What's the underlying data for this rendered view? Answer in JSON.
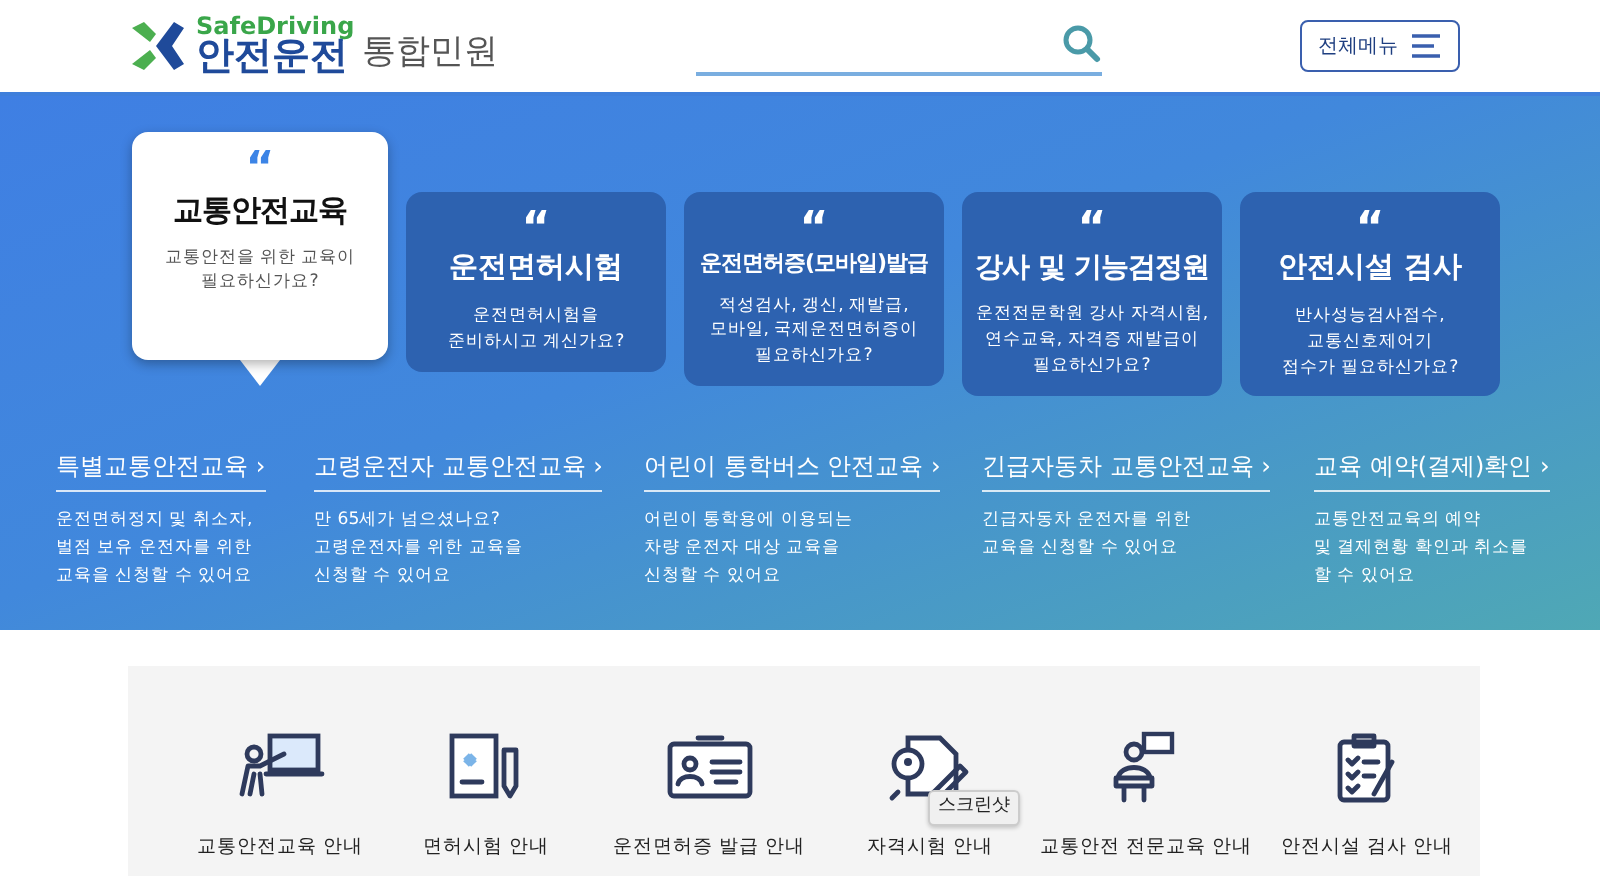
{
  "header": {
    "logo": {
      "tagline": "SafeDriving",
      "name": "안전운전",
      "suffix": "통합민원"
    },
    "menu_button": "전체메뉴"
  },
  "hero": {
    "cards": [
      {
        "mark": "“",
        "title": "교통안전교육",
        "lines": [
          "교통안전을 위한 교육이",
          "필요하신가요?"
        ],
        "selected": true
      },
      {
        "mark": "“",
        "title": "운전면허시험",
        "lines": [
          "운전면허시험을",
          "준비하시고 계신가요?"
        ],
        "selected": false
      },
      {
        "mark": "“",
        "title": "운전면허증(모바일)발급",
        "lines": [
          "적성검사, 갱신, 재발급,",
          "모바일, 국제운전면허증이",
          "필요하신가요?"
        ],
        "selected": false
      },
      {
        "mark": "“",
        "title": "강사 및 기능검정원",
        "lines": [
          "운전전문학원 강사 자격시험,",
          "연수교육, 자격증 재발급이",
          "필요하신가요?"
        ],
        "selected": false
      },
      {
        "mark": "“",
        "title": "안전시설 검사",
        "lines": [
          "반사성능검사접수,",
          "교통신호제어기",
          "접수가 필요하신가요?"
        ],
        "selected": false
      }
    ],
    "links": [
      {
        "title": "특별교통안전교육",
        "arrow": "›",
        "lines": [
          "운전면허정지 및 취소자,",
          "벌점 보유 운전자를 위한",
          "교육을 신청할 수 있어요"
        ]
      },
      {
        "title": "고령운전자 교통안전교육",
        "arrow": "›",
        "lines": [
          "만 65세가 넘으셨나요?",
          "고령운전자를 위한 교육을",
          "신청할 수 있어요"
        ]
      },
      {
        "title": "어린이 통학버스 안전교육",
        "arrow": "›",
        "lines": [
          "어린이 통학용에 이용되는",
          "차량 운전자 대상 교육을",
          "신청할 수 있어요"
        ]
      },
      {
        "title": "긴급자동차 교통안전교육",
        "arrow": "›",
        "lines": [
          "긴급자동차 운전자를 위한",
          "교육을 신청할 수 있어요"
        ]
      },
      {
        "title": "교육 예약(결제)확인",
        "arrow": "›",
        "lines": [
          "교통안전교육의 예약",
          "및 결제현황 확인과 취소를",
          "할 수 있어요"
        ]
      }
    ]
  },
  "services": [
    {
      "kind": "teacher",
      "label": "교통안전교육 안내"
    },
    {
      "kind": "document",
      "label": "면허시험 안내"
    },
    {
      "kind": "idcard",
      "label": "운전면허증 발급 안내"
    },
    {
      "kind": "exam",
      "label": "자격시험 안내"
    },
    {
      "kind": "podium",
      "label": "교통안전 전문교육 안내"
    },
    {
      "kind": "checklist",
      "label": "안전시설 검사 안내"
    }
  ],
  "tooltip": "스크린샷"
}
